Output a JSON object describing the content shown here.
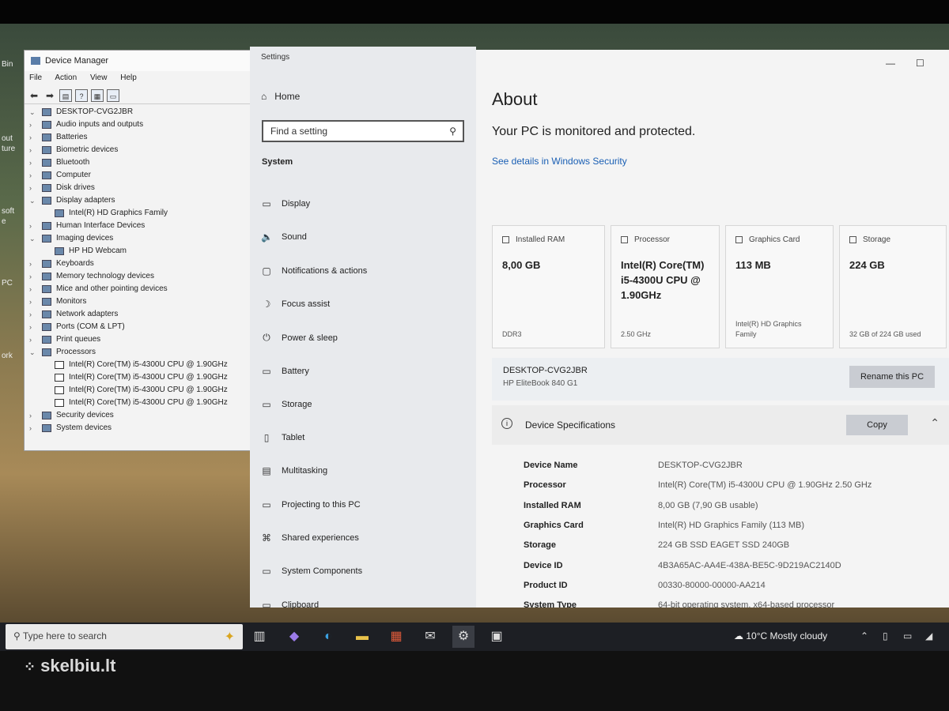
{
  "desktop": {
    "icons": [
      "Bin",
      "out",
      "ture",
      "soft",
      "e",
      "PC",
      "ork"
    ]
  },
  "device_manager": {
    "title": "Device Manager",
    "menu": [
      "File",
      "Action",
      "View",
      "Help"
    ],
    "root": "DESKTOP-CVG2JBR",
    "nodes": [
      {
        "label": "Audio inputs and outputs",
        "indent": 0,
        "arrow": "›"
      },
      {
        "label": "Batteries",
        "indent": 0,
        "arrow": "›"
      },
      {
        "label": "Biometric devices",
        "indent": 0,
        "arrow": "›"
      },
      {
        "label": "Bluetooth",
        "indent": 0,
        "arrow": "›"
      },
      {
        "label": "Computer",
        "indent": 0,
        "arrow": "›"
      },
      {
        "label": "Disk drives",
        "indent": 0,
        "arrow": "›"
      },
      {
        "label": "Display adapters",
        "indent": 0,
        "arrow": "⌄"
      },
      {
        "label": "Intel(R) HD Graphics Family",
        "indent": 1,
        "arrow": ""
      },
      {
        "label": "Human Interface Devices",
        "indent": 0,
        "arrow": "›"
      },
      {
        "label": "Imaging devices",
        "indent": 0,
        "arrow": "⌄"
      },
      {
        "label": "HP HD Webcam",
        "indent": 1,
        "arrow": ""
      },
      {
        "label": "Keyboards",
        "indent": 0,
        "arrow": "›"
      },
      {
        "label": "Memory technology devices",
        "indent": 0,
        "arrow": "›"
      },
      {
        "label": "Mice and other pointing devices",
        "indent": 0,
        "arrow": "›"
      },
      {
        "label": "Monitors",
        "indent": 0,
        "arrow": "›"
      },
      {
        "label": "Network adapters",
        "indent": 0,
        "arrow": "›"
      },
      {
        "label": "Ports (COM & LPT)",
        "indent": 0,
        "arrow": "›"
      },
      {
        "label": "Print queues",
        "indent": 0,
        "arrow": "›"
      },
      {
        "label": "Processors",
        "indent": 0,
        "arrow": "⌄"
      },
      {
        "label": "Intel(R) Core(TM) i5-4300U CPU @ 1.90GHz",
        "indent": 1,
        "arrow": "",
        "cpu": true
      },
      {
        "label": "Intel(R) Core(TM) i5-4300U CPU @ 1.90GHz",
        "indent": 1,
        "arrow": "",
        "cpu": true
      },
      {
        "label": "Intel(R) Core(TM) i5-4300U CPU @ 1.90GHz",
        "indent": 1,
        "arrow": "",
        "cpu": true
      },
      {
        "label": "Intel(R) Core(TM) i5-4300U CPU @ 1.90GHz",
        "indent": 1,
        "arrow": "",
        "cpu": true
      },
      {
        "label": "Security devices",
        "indent": 0,
        "arrow": "›"
      },
      {
        "label": "System devices",
        "indent": 0,
        "arrow": "›"
      }
    ]
  },
  "settings": {
    "title": "Settings",
    "home": "Home",
    "search_placeholder": "Find a setting",
    "section": "System",
    "nav": [
      {
        "label": "Display",
        "icon": "▭"
      },
      {
        "label": "Sound",
        "icon": "🔈"
      },
      {
        "label": "Notifications & actions",
        "icon": "▢"
      },
      {
        "label": "Focus assist",
        "icon": "☽"
      },
      {
        "label": "Power & sleep",
        "icon": "⏻"
      },
      {
        "label": "Battery",
        "icon": "▭"
      },
      {
        "label": "Storage",
        "icon": "▭"
      },
      {
        "label": "Tablet",
        "icon": "▯"
      },
      {
        "label": "Multitasking",
        "icon": "▤"
      },
      {
        "label": "Projecting to this PC",
        "icon": "▭"
      },
      {
        "label": "Shared experiences",
        "icon": "⌘"
      },
      {
        "label": "System Components",
        "icon": "▭"
      },
      {
        "label": "Clipboard",
        "icon": "▭"
      }
    ],
    "about_title": "About",
    "protected_text": "Your PC is monitored and protected.",
    "security_link": "See details in Windows Security",
    "cards": [
      {
        "head": "Installed RAM",
        "value": "8,00 GB",
        "sub": "DDR3"
      },
      {
        "head": "Processor",
        "value": "Intel(R) Core(TM) i5-4300U CPU @ 1.90GHz",
        "sub": "2.50 GHz"
      },
      {
        "head": "Graphics Card",
        "value": "113 MB",
        "sub": "Intel(R) HD Graphics Family"
      },
      {
        "head": "Storage",
        "value": "224 GB",
        "sub": "32 GB of 224 GB used"
      }
    ],
    "pc_name": "DESKTOP-CVG2JBR",
    "pc_model": "HP EliteBook 840 G1",
    "rename_button": "Rename this PC",
    "specs_title": "Device Specifications",
    "copy_button": "Copy",
    "specs": [
      {
        "key": "Device Name",
        "value": "DESKTOP-CVG2JBR"
      },
      {
        "key": "Processor",
        "value": "Intel(R) Core(TM) i5-4300U CPU @ 1.90GHz   2.50 GHz"
      },
      {
        "key": "Installed RAM",
        "value": "8,00 GB (7,90 GB usable)"
      },
      {
        "key": "Graphics Card",
        "value": "Intel(R) HD Graphics Family (113 MB)"
      },
      {
        "key": "Storage",
        "value": "224 GB SSD EAGET SSD 240GB"
      },
      {
        "key": "Device ID",
        "value": "4B3A65AC-AA4E-438A-BE5C-9D219AC2140D"
      },
      {
        "key": "Product ID",
        "value": "00330-80000-00000-AA214"
      },
      {
        "key": "System Type",
        "value": "64-bit operating system, x64-based processor"
      }
    ]
  },
  "taskbar": {
    "search_placeholder": "Type here to search",
    "weather": "10°C  Mostly cloudy"
  },
  "watermark": "skelbiu.lt"
}
